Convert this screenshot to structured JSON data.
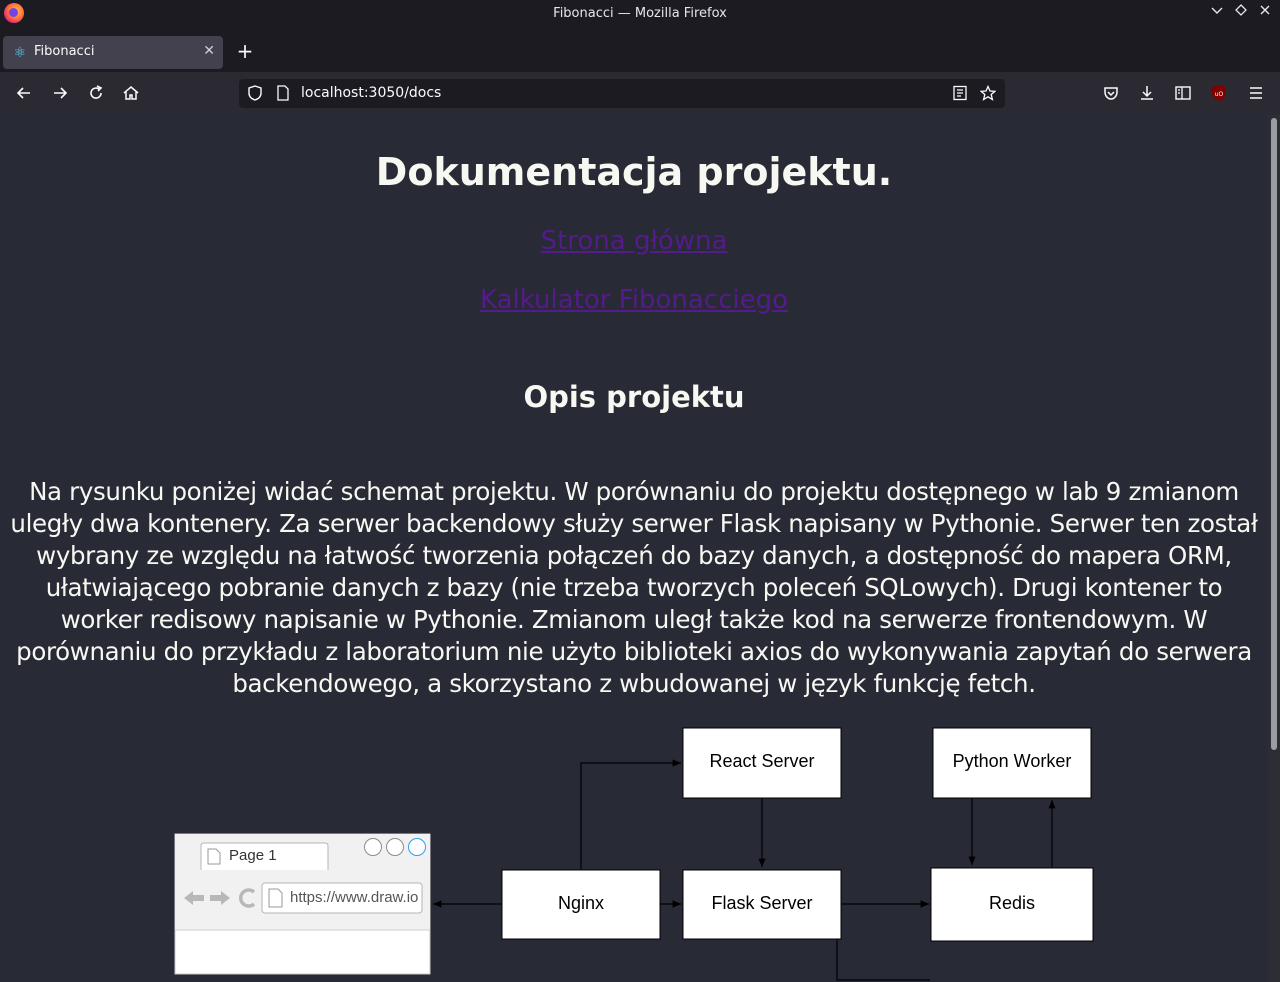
{
  "window": {
    "title": "Fibonacci — Mozilla Firefox"
  },
  "tabs": [
    {
      "label": "Fibonacci",
      "active": true
    }
  ],
  "toolbar": {
    "url": "localhost:3050/docs"
  },
  "page": {
    "title": "Dokumentacja projektu.",
    "links": [
      {
        "label": "Strona główna"
      },
      {
        "label": "Kalkulator Fibonacciego"
      }
    ],
    "section_title": "Opis projektu",
    "description": "Na rysunku poniżej widać schemat projektu. W porównaniu do projektu dostępnego w lab 9 zmianom uległy dwa kontenery. Za serwer backendowy służy serwer Flask napisany w Pythonie. Serwer ten został wybrany ze względu na łatwość tworzenia połączeń do bazy danych, a dostępność do mapera ORM, ułatwiającego pobranie danych z bazy (nie trzeba tworzych poleceń SQLowych). Drugi kontener to worker redisowy napisanie w Pythonie. Zmianom uległ także kod na serwerze frontendowym. W porównaniu do przykładu z laboratorium nie użyto biblioteki axios do wykonywania zapytań do serwera backendowego, a skorzystano z wbudowanej w język funkcję fetch."
  },
  "diagram": {
    "nodes": {
      "react": "React Server",
      "python_worker": "Python Worker",
      "nginx": "Nginx",
      "flask": "Flask Server",
      "redis": "Redis"
    },
    "browser_mock": {
      "tab_label": "Page 1",
      "url": "https://www.draw.io"
    }
  },
  "colors": {
    "page_bg": "#282a36",
    "text": "#f8f8f2",
    "link": "#551a8b",
    "chrome_dark": "#1c1b22",
    "chrome_toolbar": "#2b2a33",
    "tab_active": "#42414d"
  },
  "icons": [
    "firefox-logo-icon",
    "react-favicon-icon",
    "back-icon",
    "forward-icon",
    "reload-icon",
    "home-icon",
    "shield-icon",
    "page-icon",
    "reader-view-icon",
    "bookmark-star-icon",
    "pocket-icon",
    "download-icon",
    "sidebar-icon",
    "ublock-icon",
    "menu-icon"
  ]
}
